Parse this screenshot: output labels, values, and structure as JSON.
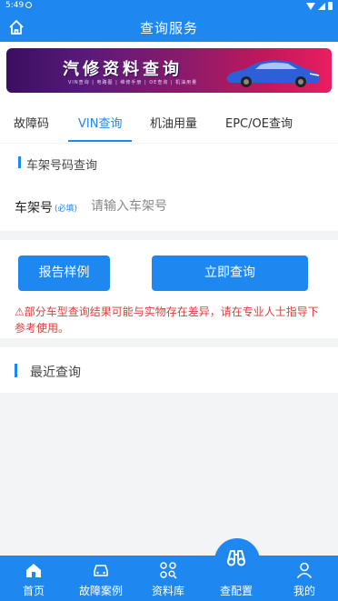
{
  "status_bar": {
    "time": "5:49"
  },
  "header": {
    "title": "查询服务"
  },
  "banner": {
    "title": "汽修资料查询",
    "subtitle": "VIN查询 | 电路图 | 维修手册 | OE查询 | 机油用量"
  },
  "tabs": [
    {
      "label": "故障码",
      "active": false
    },
    {
      "label": "VIN查询",
      "active": true
    },
    {
      "label": "机油用量",
      "active": false
    },
    {
      "label": "EPC/OE查询",
      "active": false
    }
  ],
  "vin_section": {
    "title": "车架号码查询",
    "field_label": "车架号",
    "required_tag": "(必填)",
    "placeholder": "请输入车架号",
    "value": ""
  },
  "actions": {
    "sample_label": "报告样例",
    "query_label": "立即查询"
  },
  "notice": "⚠部分车型查询结果可能与实物存在差异，请在专业人士指导下参考使用。",
  "recent": {
    "title": "最近查询"
  },
  "bottom_nav": [
    {
      "label": "首页",
      "icon": "home-icon"
    },
    {
      "label": "故障案例",
      "icon": "car-icon"
    },
    {
      "label": "资料库",
      "icon": "grid-search-icon"
    },
    {
      "label": "查配置",
      "icon": "binoculars-icon"
    },
    {
      "label": "我的",
      "icon": "user-icon"
    }
  ],
  "colors": {
    "primary": "#1e88f0",
    "warning": "#e03c3c",
    "background": "#f3f4f6"
  }
}
